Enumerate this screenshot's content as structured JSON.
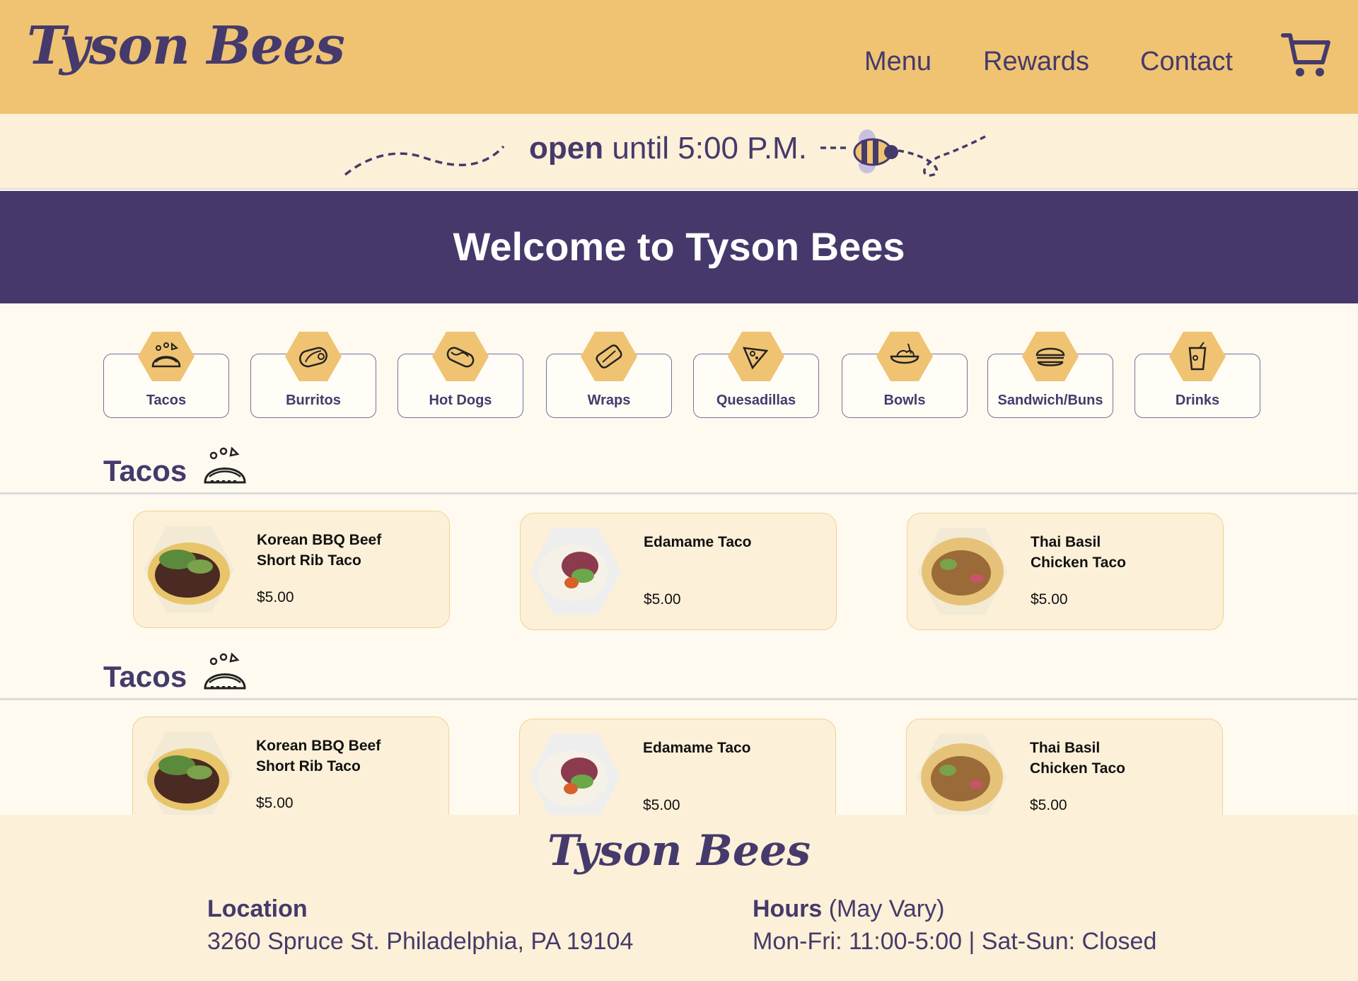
{
  "brand": {
    "name": "Tyson Bees"
  },
  "nav": {
    "menu": "Menu",
    "rewards": "Rewards",
    "contact": "Contact"
  },
  "status": {
    "open_word": "open",
    "until_text": "until 5:00 P.M."
  },
  "hero": {
    "title": "Welcome to Tyson Bees"
  },
  "categories": [
    {
      "label": "Tacos",
      "icon": "taco-icon"
    },
    {
      "label": "Burritos",
      "icon": "burrito-icon"
    },
    {
      "label": "Hot Dogs",
      "icon": "hot-dog-icon"
    },
    {
      "label": "Wraps",
      "icon": "wrap-icon"
    },
    {
      "label": "Quesadillas",
      "icon": "quesadilla-icon"
    },
    {
      "label": "Bowls",
      "icon": "bowl-icon"
    },
    {
      "label": "Sandwich/Buns",
      "icon": "sandwich-icon"
    },
    {
      "label": "Drinks",
      "icon": "drink-icon"
    }
  ],
  "sections": [
    {
      "title": "Tacos",
      "icon": "taco-icon",
      "items": [
        {
          "name_line1": "Korean BBQ Beef",
          "name_line2": "Short Rib Taco",
          "price": "$5.00"
        },
        {
          "name_line1": "Edamame Taco",
          "name_line2": "",
          "price": "$5.00"
        },
        {
          "name_line1": "Thai Basil",
          "name_line2": "Chicken Taco",
          "price": "$5.00"
        }
      ]
    },
    {
      "title": "Tacos",
      "icon": "taco-icon",
      "items": [
        {
          "name_line1": "Korean BBQ Beef",
          "name_line2": "Short Rib Taco",
          "price": "$5.00"
        },
        {
          "name_line1": "Edamame Taco",
          "name_line2": "",
          "price": "$5.00"
        },
        {
          "name_line1": "Thai Basil",
          "name_line2": "Chicken Taco",
          "price": "$5.00"
        }
      ]
    }
  ],
  "footer": {
    "location_label": "Location",
    "location_value": "3260 Spruce St. Philadelphia, PA 19104",
    "hours_label": "Hours",
    "hours_note": "(May Vary)",
    "hours_value": "Mon-Fri: 11:00-5:00 | Sat-Sun: Closed"
  },
  "colors": {
    "header_bg": "#efc372",
    "strip_bg": "#fdf0d8",
    "brand_purple": "#46386b",
    "page_bg": "#fefaf0",
    "card_bg": "#fdf0d8"
  }
}
